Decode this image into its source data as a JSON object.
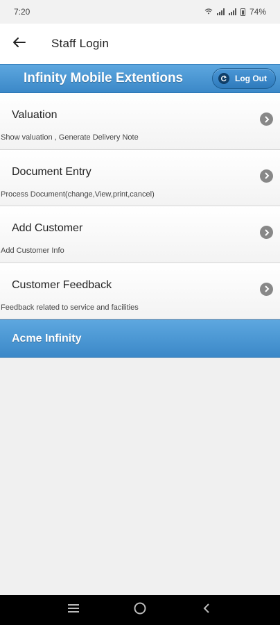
{
  "status_bar": {
    "time": "7:20",
    "battery": "74%"
  },
  "app_bar": {
    "title": "Staff Login",
    "back_icon": "arrow-left-icon"
  },
  "brand_bar": {
    "title": "Infinity Mobile Extentions",
    "logout_label": "Log Out"
  },
  "menu": {
    "items": [
      {
        "label": "Valuation",
        "description": "Show valuation , Generate Delivery Note"
      },
      {
        "label": "Document Entry",
        "description": "Process Document(change,View,print,cancel)"
      },
      {
        "label": "Add Customer",
        "description": "Add Customer Info"
      },
      {
        "label": "Customer Feedback",
        "description": "Feedback related to service and facilities"
      }
    ]
  },
  "footer": {
    "text": "Acme Infinity"
  },
  "colors": {
    "accent": "#3b88c8",
    "accent_light": "#5da7df"
  }
}
